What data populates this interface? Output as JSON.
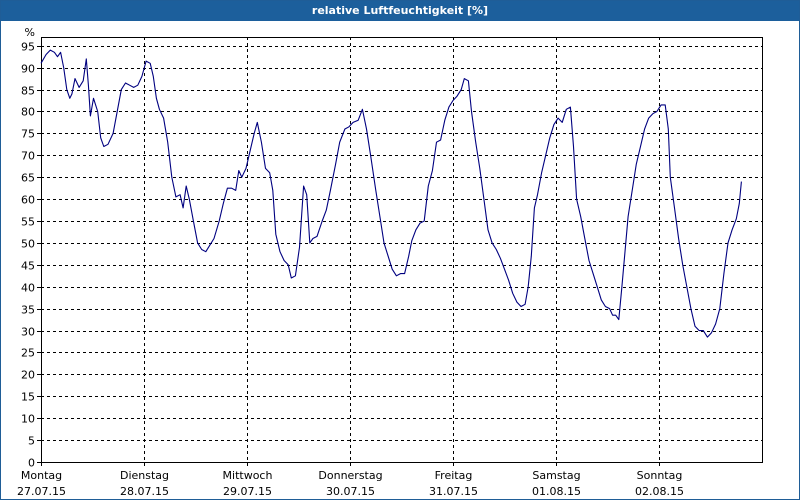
{
  "chart_data": {
    "type": "line",
    "title": "relative Luftfeuchtigkeit [%]",
    "ylabel": "%",
    "xlabel": "",
    "ylim": [
      0,
      97
    ],
    "yticks": [
      0,
      5,
      10,
      15,
      20,
      25,
      30,
      35,
      40,
      45,
      50,
      55,
      60,
      65,
      70,
      75,
      80,
      85,
      90,
      95
    ],
    "grid": true,
    "xlim": [
      0,
      7
    ],
    "days": [
      {
        "day": "Montag",
        "date": "27.07.15"
      },
      {
        "day": "Dienstag",
        "date": "28.07.15"
      },
      {
        "day": "Mittwoch",
        "date": "29.07.15"
      },
      {
        "day": "Donnerstag",
        "date": "30.07.15"
      },
      {
        "day": "Freitag",
        "date": "31.07.15"
      },
      {
        "day": "Samstag",
        "date": "01.08.15"
      },
      {
        "day": "Sonntag",
        "date": "02.08.15"
      }
    ],
    "line_color": "#000080",
    "series": [
      {
        "points": [
          [
            0.0,
            91
          ],
          [
            0.05,
            93
          ],
          [
            0.09,
            94
          ],
          [
            0.13,
            93.5
          ],
          [
            0.16,
            92.5
          ],
          [
            0.19,
            93.5
          ],
          [
            0.22,
            90
          ],
          [
            0.25,
            85
          ],
          [
            0.28,
            83
          ],
          [
            0.3,
            84
          ],
          [
            0.33,
            87.5
          ],
          [
            0.37,
            85.5
          ],
          [
            0.41,
            87
          ],
          [
            0.44,
            92
          ],
          [
            0.46,
            86
          ],
          [
            0.48,
            79
          ],
          [
            0.51,
            83
          ],
          [
            0.55,
            80
          ],
          [
            0.58,
            74
          ],
          [
            0.61,
            72
          ],
          [
            0.65,
            72.5
          ],
          [
            0.7,
            75
          ],
          [
            0.74,
            80
          ],
          [
            0.78,
            85
          ],
          [
            0.82,
            86.5
          ],
          [
            0.86,
            86
          ],
          [
            0.9,
            85.5
          ],
          [
            0.94,
            86
          ],
          [
            0.98,
            88
          ],
          [
            1.02,
            91.5
          ],
          [
            1.06,
            91
          ],
          [
            1.09,
            88
          ],
          [
            1.12,
            83
          ],
          [
            1.15,
            80.5
          ],
          [
            1.19,
            78.5
          ],
          [
            1.23,
            73
          ],
          [
            1.27,
            65
          ],
          [
            1.31,
            60.5
          ],
          [
            1.35,
            61
          ],
          [
            1.38,
            58
          ],
          [
            1.41,
            63
          ],
          [
            1.44,
            60
          ],
          [
            1.48,
            55
          ],
          [
            1.52,
            50
          ],
          [
            1.56,
            48.5
          ],
          [
            1.6,
            48
          ],
          [
            1.64,
            49.5
          ],
          [
            1.68,
            51
          ],
          [
            1.73,
            55
          ],
          [
            1.77,
            59
          ],
          [
            1.81,
            62.5
          ],
          [
            1.85,
            62.5
          ],
          [
            1.89,
            62
          ],
          [
            1.92,
            66.5
          ],
          [
            1.95,
            65
          ],
          [
            1.99,
            67
          ],
          [
            2.03,
            71
          ],
          [
            2.07,
            75
          ],
          [
            2.1,
            77.5
          ],
          [
            2.14,
            73
          ],
          [
            2.18,
            67
          ],
          [
            2.22,
            66
          ],
          [
            2.25,
            62
          ],
          [
            2.28,
            52
          ],
          [
            2.32,
            48
          ],
          [
            2.36,
            46
          ],
          [
            2.4,
            45
          ],
          [
            2.43,
            42
          ],
          [
            2.47,
            42.5
          ],
          [
            2.51,
            49
          ],
          [
            2.55,
            63
          ],
          [
            2.58,
            61
          ],
          [
            2.61,
            50
          ],
          [
            2.64,
            51
          ],
          [
            2.68,
            51.5
          ],
          [
            2.73,
            55
          ],
          [
            2.77,
            57.5
          ],
          [
            2.81,
            62
          ],
          [
            2.86,
            68
          ],
          [
            2.9,
            73
          ],
          [
            2.95,
            76
          ],
          [
            2.99,
            76.5
          ],
          [
            3.03,
            77.5
          ],
          [
            3.08,
            78
          ],
          [
            3.12,
            80.5
          ],
          [
            3.16,
            76
          ],
          [
            3.2,
            70
          ],
          [
            3.25,
            62
          ],
          [
            3.29,
            56
          ],
          [
            3.33,
            50
          ],
          [
            3.37,
            47
          ],
          [
            3.41,
            44
          ],
          [
            3.45,
            42.5
          ],
          [
            3.49,
            43
          ],
          [
            3.53,
            43
          ],
          [
            3.57,
            47
          ],
          [
            3.6,
            50.5
          ],
          [
            3.64,
            53
          ],
          [
            3.68,
            54.5
          ],
          [
            3.72,
            55
          ],
          [
            3.76,
            63
          ],
          [
            3.8,
            66.5
          ],
          [
            3.84,
            73
          ],
          [
            3.88,
            73.5
          ],
          [
            3.92,
            78
          ],
          [
            3.96,
            81
          ],
          [
            4.0,
            82.5
          ],
          [
            4.04,
            83.5
          ],
          [
            4.08,
            85
          ],
          [
            4.11,
            87.5
          ],
          [
            4.15,
            87
          ],
          [
            4.18,
            80
          ],
          [
            4.22,
            73
          ],
          [
            4.26,
            67
          ],
          [
            4.3,
            60
          ],
          [
            4.34,
            53
          ],
          [
            4.38,
            50
          ],
          [
            4.42,
            48.5
          ],
          [
            4.46,
            46.5
          ],
          [
            4.5,
            44
          ],
          [
            4.54,
            41.5
          ],
          [
            4.58,
            38.5
          ],
          [
            4.62,
            36.5
          ],
          [
            4.66,
            35.5
          ],
          [
            4.7,
            36
          ],
          [
            4.73,
            40
          ],
          [
            4.76,
            47
          ],
          [
            4.79,
            58
          ],
          [
            4.82,
            61
          ],
          [
            4.86,
            66
          ],
          [
            4.9,
            70
          ],
          [
            4.94,
            74
          ],
          [
            4.98,
            77
          ],
          [
            5.02,
            78.5
          ],
          [
            5.06,
            77.5
          ],
          [
            5.1,
            80.5
          ],
          [
            5.14,
            81
          ],
          [
            5.17,
            72
          ],
          [
            5.2,
            60
          ],
          [
            5.24,
            56
          ],
          [
            5.28,
            51
          ],
          [
            5.32,
            46
          ],
          [
            5.36,
            43
          ],
          [
            5.4,
            40
          ],
          [
            5.44,
            37
          ],
          [
            5.48,
            35.5
          ],
          [
            5.52,
            35
          ],
          [
            5.55,
            33.5
          ],
          [
            5.58,
            33.5
          ],
          [
            5.61,
            32.5
          ],
          [
            5.64,
            40
          ],
          [
            5.67,
            48
          ],
          [
            5.7,
            56
          ],
          [
            5.74,
            62
          ],
          [
            5.78,
            68
          ],
          [
            5.82,
            72
          ],
          [
            5.86,
            76
          ],
          [
            5.9,
            78.5
          ],
          [
            5.94,
            79.5
          ],
          [
            5.98,
            80
          ],
          [
            6.02,
            81.5
          ],
          [
            6.06,
            81.5
          ],
          [
            6.09,
            76
          ],
          [
            6.11,
            65
          ],
          [
            6.15,
            58
          ],
          [
            6.19,
            51
          ],
          [
            6.23,
            45
          ],
          [
            6.27,
            40
          ],
          [
            6.31,
            35
          ],
          [
            6.35,
            31
          ],
          [
            6.39,
            30
          ],
          [
            6.43,
            30
          ],
          [
            6.47,
            28.5
          ],
          [
            6.51,
            29.5
          ],
          [
            6.55,
            31.5
          ],
          [
            6.59,
            35
          ],
          [
            6.63,
            43
          ],
          [
            6.67,
            50
          ],
          [
            6.71,
            53
          ],
          [
            6.75,
            55.5
          ],
          [
            6.78,
            59
          ],
          [
            6.8,
            64
          ]
        ]
      }
    ]
  }
}
